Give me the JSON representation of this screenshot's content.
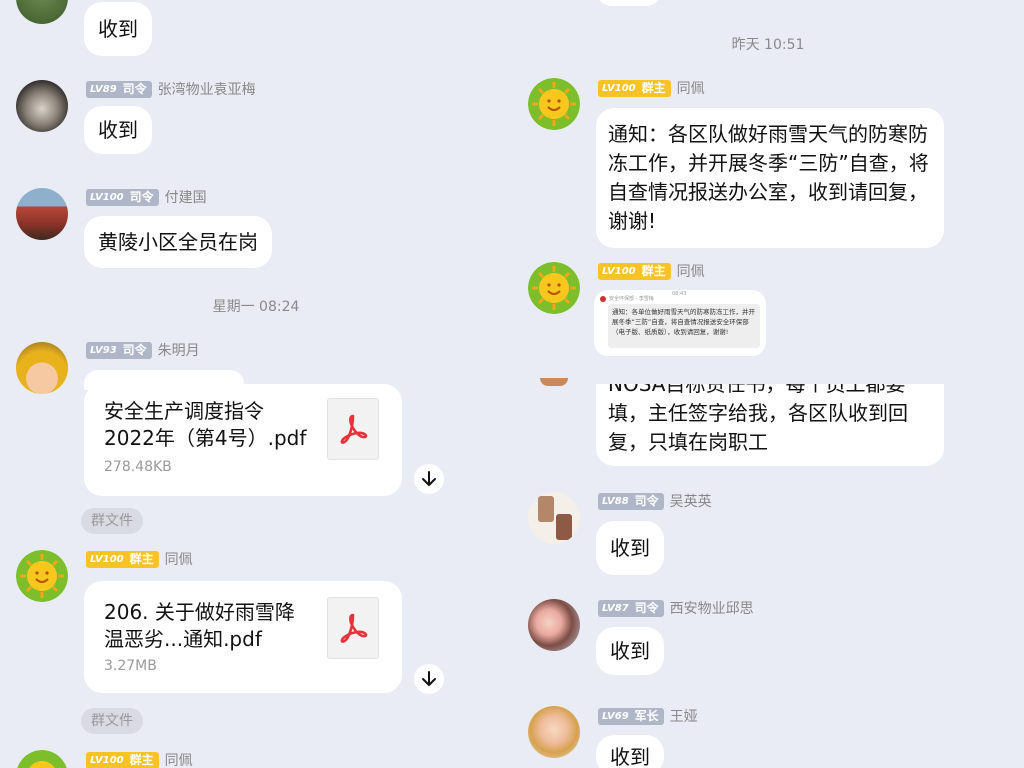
{
  "left": {
    "messages": [
      {
        "text": "收到"
      },
      {
        "level": "LV89",
        "rank": "司令",
        "name": "张湾物业袁亚梅",
        "text": "收到"
      },
      {
        "level": "LV100",
        "rank": "司令",
        "name": "付建国",
        "text": "黄陵小区全员在岗"
      },
      {
        "level": "LV93",
        "rank": "司令",
        "name": "朱明月"
      },
      {
        "level": "LV100",
        "rank": "群主",
        "name": "同佩"
      },
      {
        "level": "LV100",
        "rank": "群主",
        "name": "同佩"
      }
    ],
    "time1": "星期一 08:24",
    "file1": {
      "name": "安全生产调度指令2022年（第4号）.pdf",
      "size": "278.48KB"
    },
    "file2": {
      "name": "206. 关于做好雨雪降温恶劣...通知.pdf",
      "size": "3.27MB"
    },
    "group_file_tag": "群文件"
  },
  "right": {
    "time": "昨天 10:51",
    "messages": [
      {
        "level": "LV100",
        "rank": "群主",
        "name": "同佩",
        "text": "通知：各区队做好雨雪天气的防寒防冻工作，并开展冬季“三防”自查，将自查情况报送办公室，收到请回复，谢谢!"
      },
      {
        "level": "LV100",
        "rank": "群主",
        "name": "同佩"
      },
      {
        "text": "NOSA目标责任书，每个员工都要填，主任签字给我，各区队收到回复，只填在岗职工"
      },
      {
        "level": "LV88",
        "rank": "司令",
        "name": "吴英英",
        "text": "收到"
      },
      {
        "level": "LV87",
        "rank": "司令",
        "name": "西安物业邱思",
        "text": "收到"
      },
      {
        "level": "LV69",
        "rank": "军长",
        "name": "王娅",
        "text": "收到"
      }
    ],
    "thumb": {
      "sender": "安全环保部 · 李雪梅",
      "time": "08:43",
      "text": "通知：各单位做好雨雪天气的防寒防冻工作，并开展冬季“三防”自查，将自查情况报送安全环保部（电子版、纸质版），收到请回复，谢谢!"
    }
  },
  "colors": {
    "background": "#e9ecf4",
    "badge_grey": "#aeb6c8",
    "badge_gold": "#f9c326",
    "pdf_red": "#e8313a"
  }
}
